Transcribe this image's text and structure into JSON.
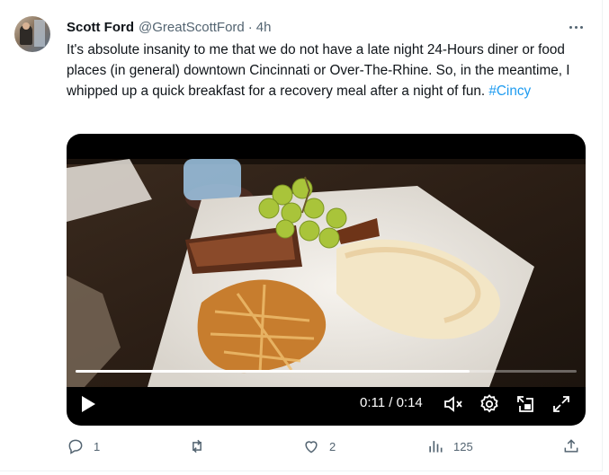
{
  "tweet": {
    "author_name": "Scott Ford",
    "handle": "@GreatScottFord",
    "separator": "·",
    "time": "4h",
    "body": "It's absolute insanity to me that we do not have a late night 24-Hours diner or food places (in general) downtown Cincinnati or Over-The-Rhine. So, in the meantime, I whipped up a quick breakfast for a recovery meal after a night of fun.",
    "hashtag": "#Cincy"
  },
  "video": {
    "timecode": "0:11 / 0:14",
    "progress": 0.786,
    "icons": [
      "play-icon",
      "mute-icon",
      "settings-icon",
      "picture-in-picture-icon",
      "fullscreen-icon"
    ]
  },
  "actions": {
    "replies": "1",
    "reposts": "",
    "likes": "2",
    "views": "125"
  },
  "colors": {
    "accent": "#1d9bf0",
    "secondary_text": "#536471",
    "primary_text": "#0f1419"
  }
}
